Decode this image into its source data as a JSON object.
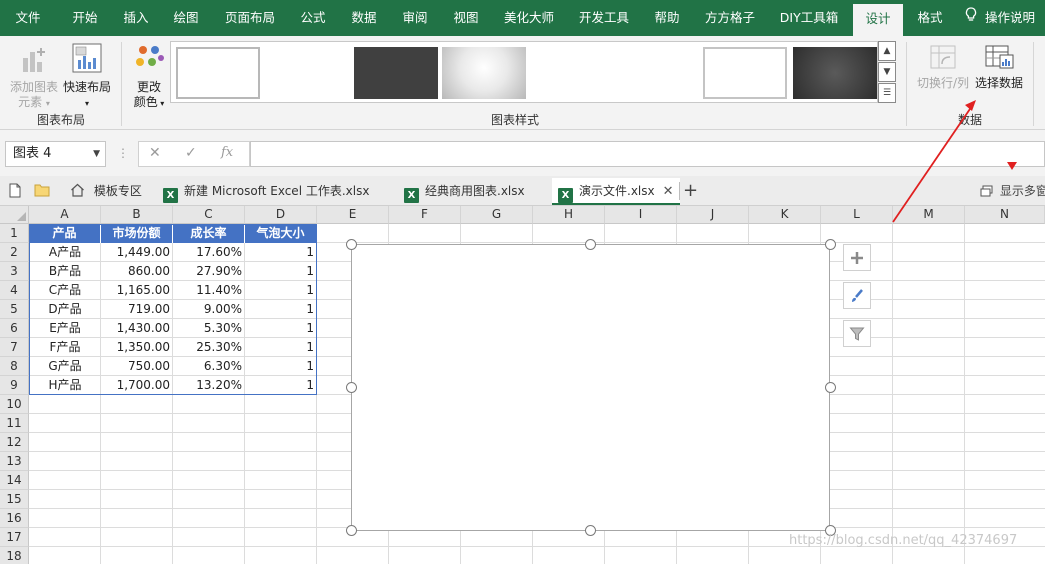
{
  "menu": {
    "tabs": [
      {
        "label": "文件"
      },
      {
        "label": "开始"
      },
      {
        "label": "插入"
      },
      {
        "label": "绘图"
      },
      {
        "label": "页面布局"
      },
      {
        "label": "公式"
      },
      {
        "label": "数据"
      },
      {
        "label": "审阅"
      },
      {
        "label": "视图"
      },
      {
        "label": "美化大师"
      },
      {
        "label": "开发工具"
      },
      {
        "label": "帮助"
      },
      {
        "label": "方方格子"
      },
      {
        "label": "DIY工具箱"
      },
      {
        "label": "设计"
      },
      {
        "label": "格式"
      }
    ],
    "active_tab": "设计",
    "tell_me": "操作说明"
  },
  "ribbon": {
    "chart_layout": {
      "add_element": "添加图表元素",
      "add_element_line1": "添加图表",
      "add_element_line2": "元素",
      "quick_layout": "快速布局",
      "group_label": "图表布局"
    },
    "change_colors_line1": "更改",
    "change_colors_line2": "颜色",
    "chart_styles_label": "图表样式",
    "data": {
      "switch_row_col": "切换行/列",
      "select_data": "选择数据",
      "group_label": "数据"
    }
  },
  "formula_bar": {
    "name_box": "图表 4",
    "fx_label": "fx",
    "value": ""
  },
  "workbook_tabs": [
    {
      "label": "模板专区"
    },
    {
      "label": "新建 Microsoft Excel 工作表.xlsx"
    },
    {
      "label": "经典商用图表.xlsx"
    },
    {
      "label": "演示文件.xlsx"
    }
  ],
  "multi_window": "显示多窗",
  "grid": {
    "columns": [
      "A",
      "B",
      "C",
      "D",
      "E",
      "F",
      "G",
      "H",
      "I",
      "J",
      "K",
      "L",
      "M",
      "N"
    ],
    "rows": [
      "1",
      "2",
      "3",
      "4",
      "5",
      "6",
      "7",
      "8",
      "9",
      "10",
      "11",
      "12",
      "13",
      "14",
      "15",
      "16",
      "17",
      "18"
    ],
    "table_headers": [
      "产品",
      "市场份额",
      "成长率",
      "气泡大小"
    ],
    "table_rows": [
      [
        "A产品",
        "1,449.00",
        "17.60%",
        "1"
      ],
      [
        "B产品",
        "860.00",
        "27.90%",
        "1"
      ],
      [
        "C产品",
        "1,165.00",
        "11.40%",
        "1"
      ],
      [
        "D产品",
        "719.00",
        "9.00%",
        "1"
      ],
      [
        "E产品",
        "1,430.00",
        "5.30%",
        "1"
      ],
      [
        "F产品",
        "1,350.00",
        "25.30%",
        "1"
      ],
      [
        "G产品",
        "750.00",
        "6.30%",
        "1"
      ],
      [
        "H产品",
        "1,700.00",
        "13.20%",
        "1"
      ]
    ]
  },
  "chart_tools": [
    "plus-icon",
    "brush-icon",
    "filter-icon"
  ],
  "annotation_color": "#e02020",
  "accent_color": "#217346",
  "header_fill": "#4472c4",
  "watermark": "https://blog.csdn.net/qq_42374697"
}
